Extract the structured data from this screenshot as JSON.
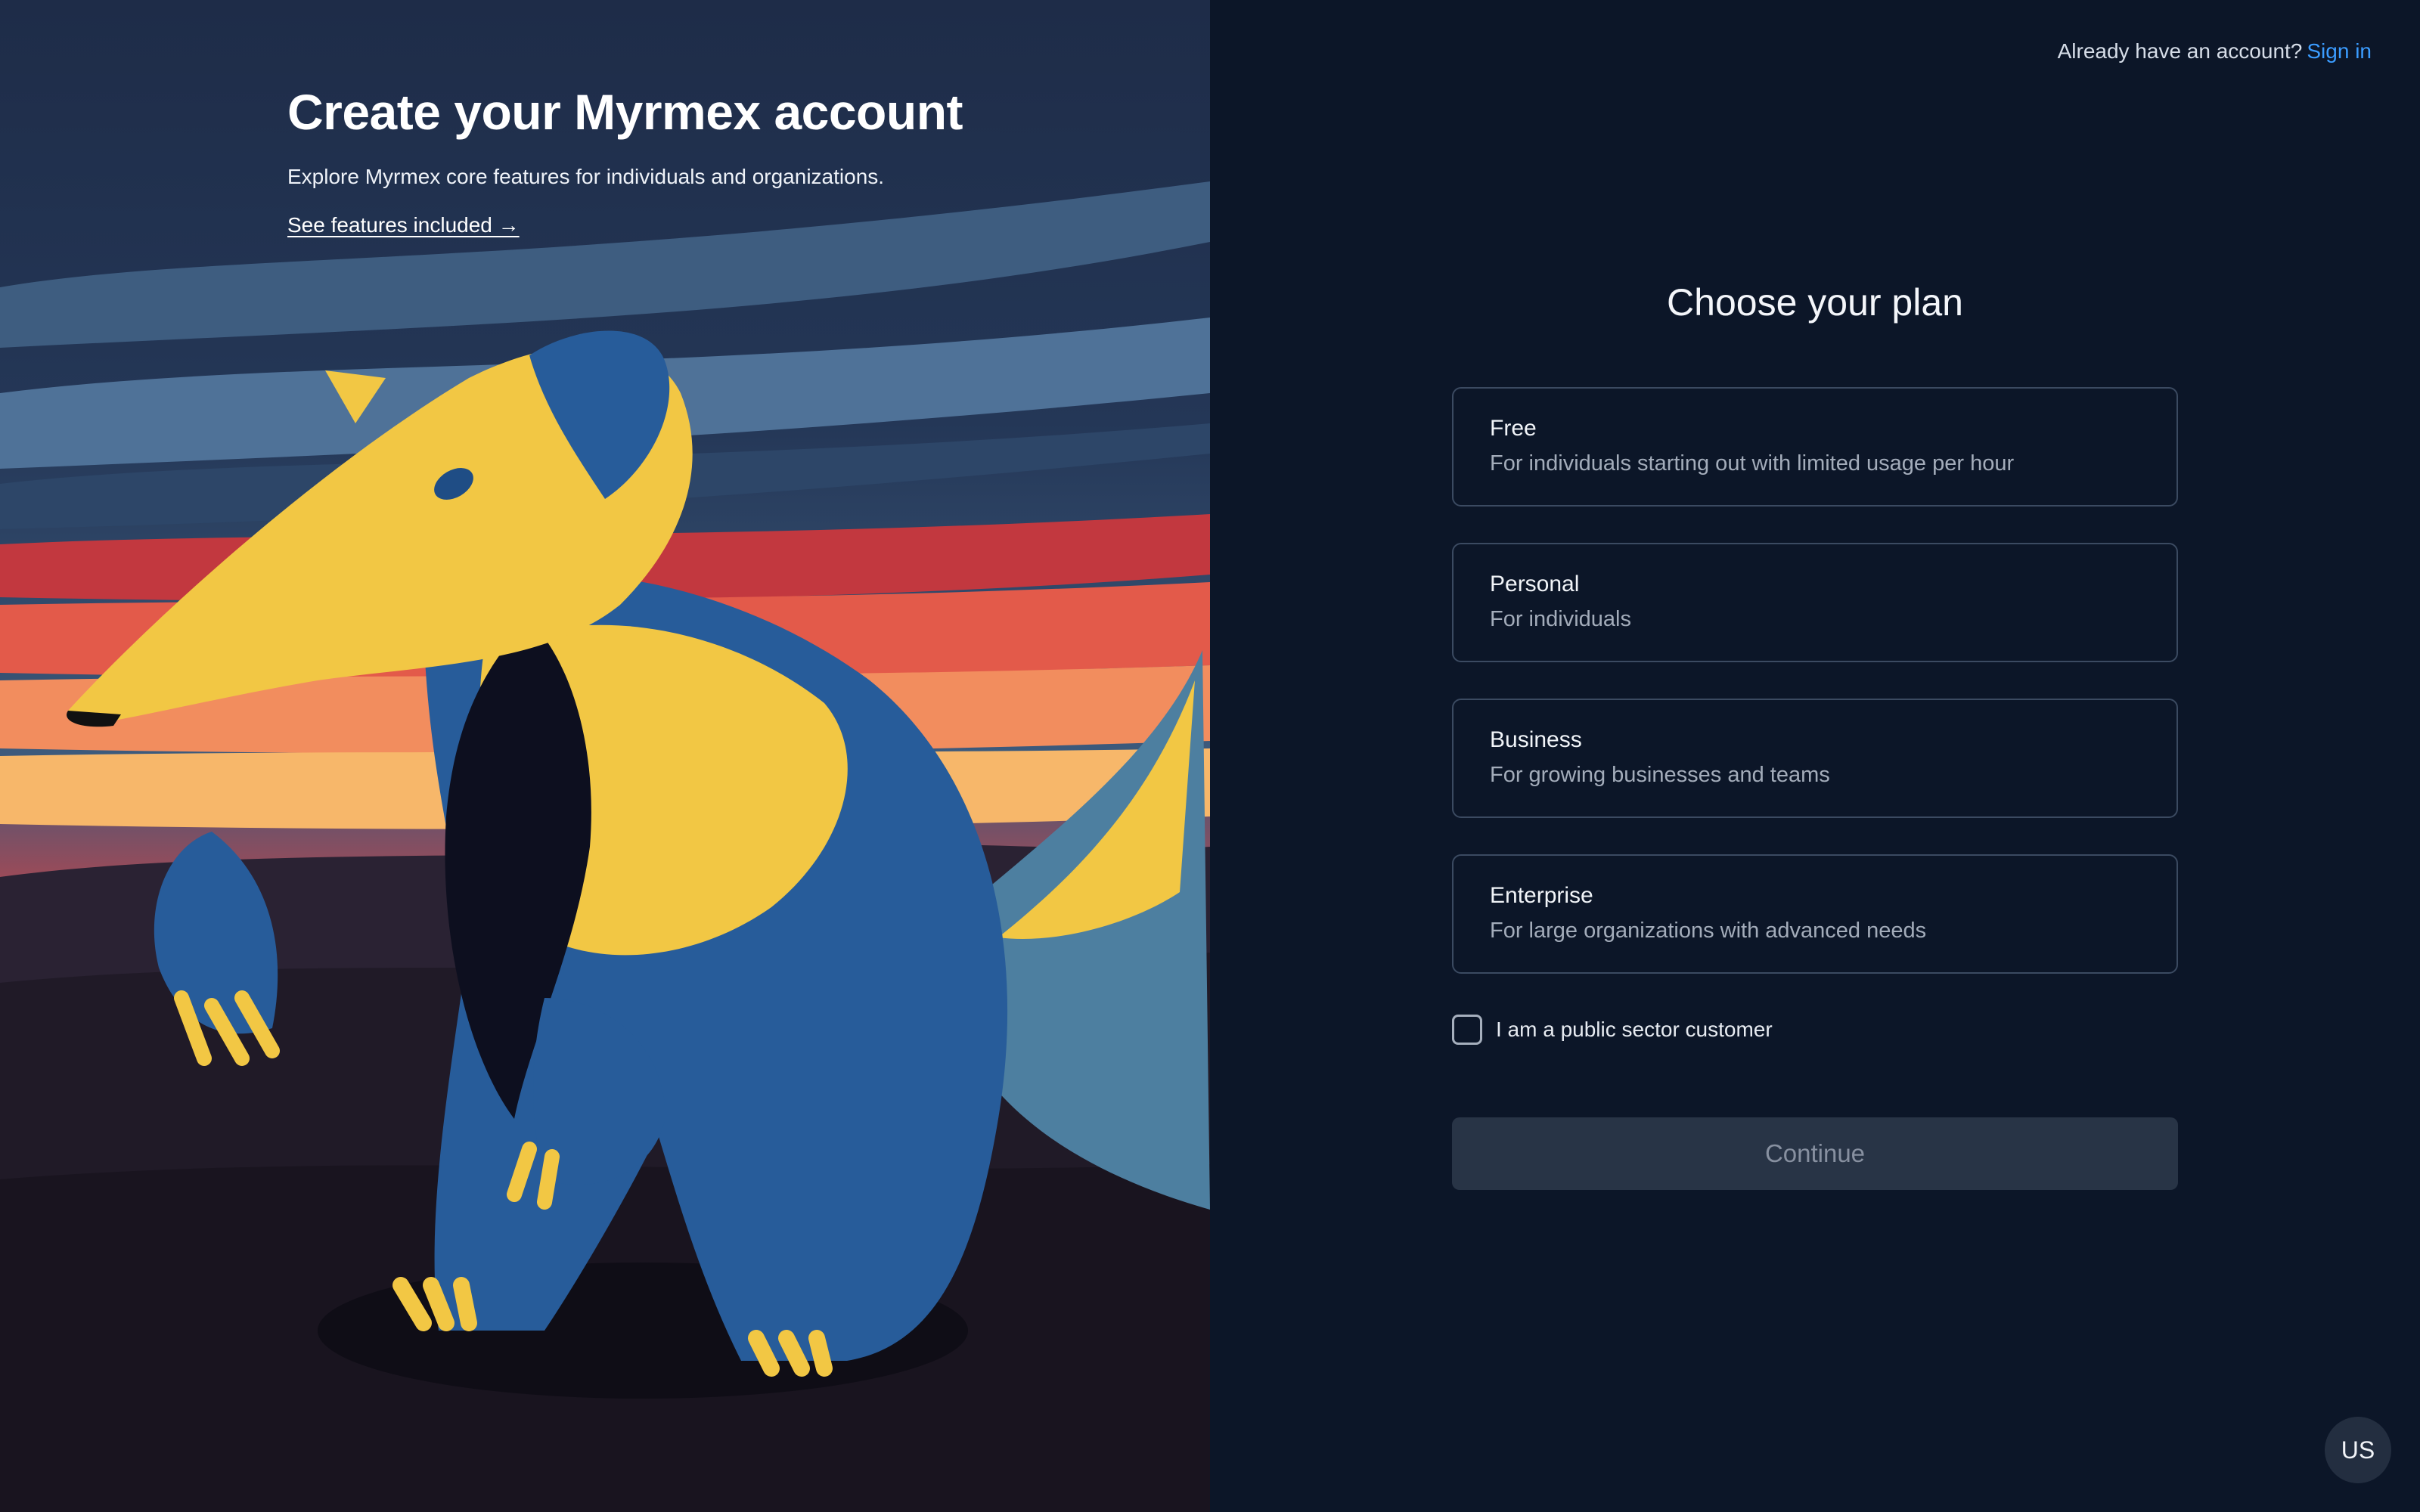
{
  "hero": {
    "title": "Create your Myrmex account",
    "subtitle": "Explore Myrmex core features for individuals and organizations.",
    "features_link": "See features included →"
  },
  "header": {
    "signin_prompt": "Already have an account?",
    "signin_label": "Sign in"
  },
  "form": {
    "title": "Choose your plan",
    "plans": [
      {
        "name": "Free",
        "description": "For individuals starting out with limited usage per hour"
      },
      {
        "name": "Personal",
        "description": "For individuals"
      },
      {
        "name": "Business",
        "description": "For growing businesses and teams"
      },
      {
        "name": "Enterprise",
        "description": "For large organizations with advanced needs"
      }
    ],
    "public_sector_label": "I am a public sector customer",
    "public_sector_checked": false,
    "continue_label": "Continue",
    "continue_enabled": false
  },
  "locale": {
    "label": "US"
  },
  "icons": {
    "hero_illustration": "anteater-illustration-icon",
    "checkbox": "checkbox-icon"
  },
  "colors": {
    "link": "#3b9cff",
    "panel_bg": "#0c1628",
    "card_border": "#3b4a61",
    "button_disabled_bg": "#283446",
    "mascot_yellow": "#f2c744",
    "mascot_blue": "#275c9a"
  }
}
